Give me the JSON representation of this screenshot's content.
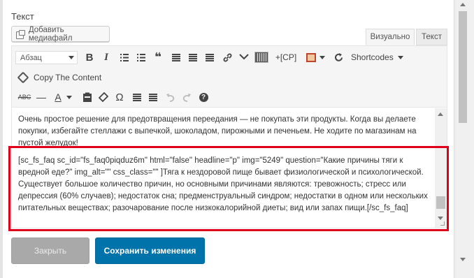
{
  "field_label": "Текст",
  "media_button": "Добавить медиафайл",
  "tabs": {
    "visual": "Визуально",
    "text": "Текст"
  },
  "toolbar": {
    "format_select": "Абзац",
    "bold": "B",
    "italic": "I",
    "blockquote": "❝",
    "cp": "+[CP]",
    "shortcodes": "Shortcodes",
    "copy_content": "Copy The Content",
    "strike": "ABC",
    "hr": "—",
    "text_color": "A",
    "omega": "Ω",
    "help": "?"
  },
  "content": {
    "paragraph1": "Очень простое решение для предотвращения переедания — не покупать эти продукты. Когда вы делаете покупки, избегайте стеллажи с выпечкой, шоколадом, пирожными и печеньем. Не ходите по магазинам на пустой желудок!",
    "paragraph2": "[sc_fs_faq sc_id=\"fs_faq0piqduz6m\" html=\"false\" headline=\"p\" img=\"5249\" question=\"Какие причины тяги к вредной еде?\" img_alt=\"\" css_class=\"\" ]Тяга к нездоровой пище бывает физиологической и психологической. Существует большое количество причин, но основными причинами являются: тревожность; стресс или депрессия (60% случаев); недостаток сна; предменструальный синдром; недостатки в одном или нескольких питательных веществах; разочарование после низкокалорийной диеты; вид или запах пищи.[/sc_fs_faq]"
  },
  "buttons": {
    "close": "Закрыть",
    "save": "Сохранить изменения"
  },
  "colors": {
    "accent": "#0073aa",
    "highlight": "#e0001b"
  }
}
